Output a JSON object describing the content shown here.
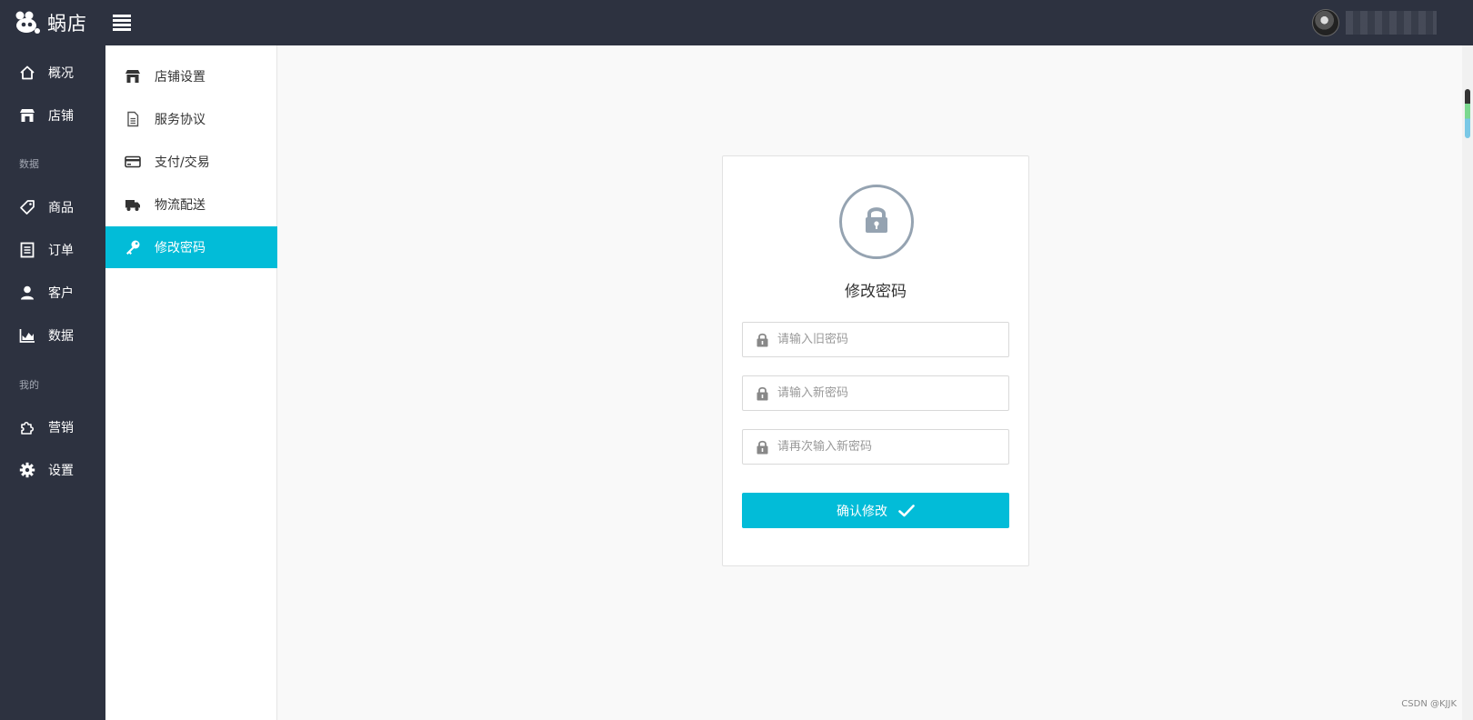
{
  "app": {
    "name": "蜗店"
  },
  "colors": {
    "topbar": "#2d3240",
    "accent": "#02bcd8",
    "lock_gray": "#95a3b1"
  },
  "leftnav": {
    "items": [
      {
        "label": "概况",
        "icon": "home-icon"
      },
      {
        "label": "店铺",
        "icon": "store-icon"
      }
    ],
    "section_data": "数据",
    "data_items": [
      {
        "label": "商品",
        "icon": "tag-icon"
      },
      {
        "label": "订单",
        "icon": "order-icon"
      },
      {
        "label": "客户",
        "icon": "user-icon"
      },
      {
        "label": "数据",
        "icon": "chart-icon"
      }
    ],
    "section_mine": "我的",
    "mine_items": [
      {
        "label": "营销",
        "icon": "puzzle-icon"
      },
      {
        "label": "设置",
        "icon": "gear-icon"
      }
    ]
  },
  "subnav": {
    "items": [
      {
        "label": "店铺设置",
        "icon": "store-icon"
      },
      {
        "label": "服务协议",
        "icon": "document-icon"
      },
      {
        "label": "支付/交易",
        "icon": "credit-card-icon"
      },
      {
        "label": "物流配送",
        "icon": "truck-icon"
      },
      {
        "label": "修改密码",
        "icon": "key-icon",
        "active": true
      }
    ]
  },
  "form": {
    "title": "修改密码",
    "old_password_placeholder": "请输入旧密码",
    "new_password_placeholder": "请输入新密码",
    "confirm_password_placeholder": "请再次输入新密码",
    "submit_label": "确认修改"
  },
  "watermark": "CSDN @KJJK"
}
